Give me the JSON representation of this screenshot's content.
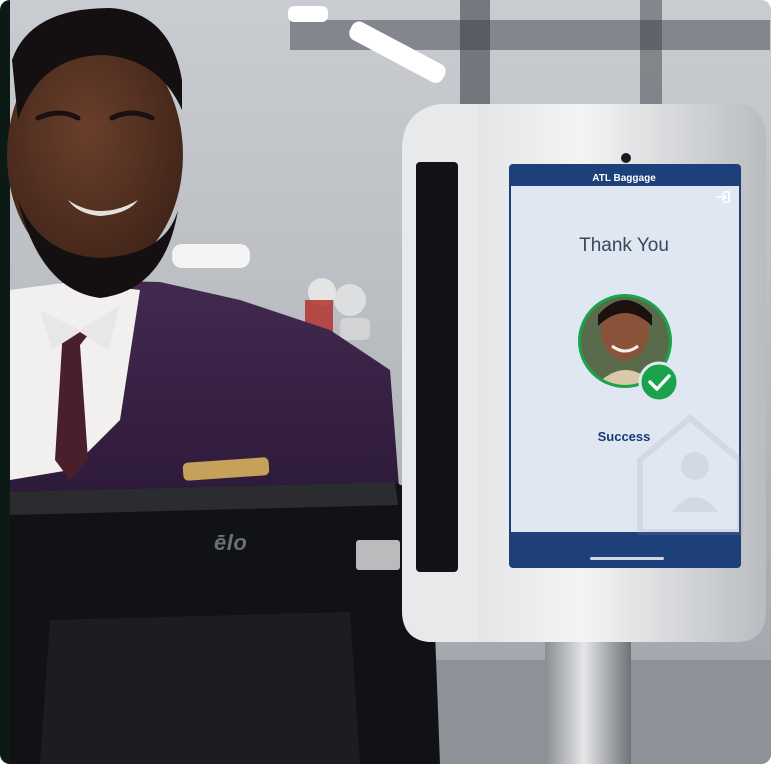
{
  "photo": {
    "kiosk_title": "ATL Baggage",
    "screen_heading": "Thank You",
    "screen_status": "Success",
    "monitor_brand": "ēlo"
  },
  "colors": {
    "screen_header": "#1d3f7a",
    "screen_background": "#dfe8f2",
    "success_green": "#1aa34a",
    "uniform_purple": "#3a2446"
  },
  "icons": {
    "exit": "exit-icon",
    "checkmark": "checkmark-icon",
    "watermark": "face-id-watermark-icon"
  }
}
